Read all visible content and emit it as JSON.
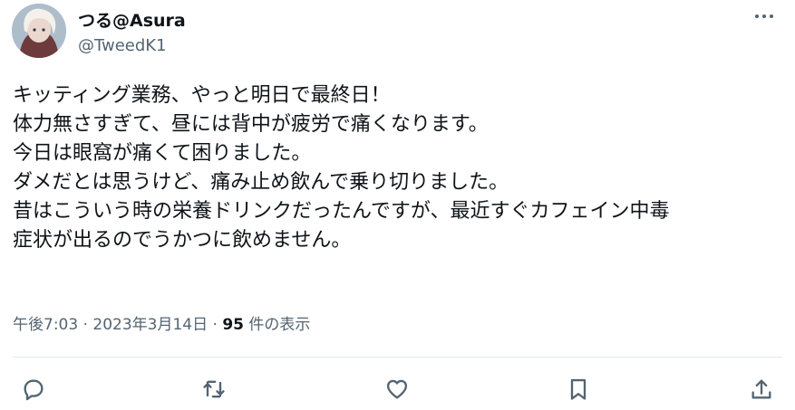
{
  "user": {
    "display_name": "つる@Asura",
    "handle": "@TweedK1",
    "avatar_icon": "avatar-photo"
  },
  "menu": {
    "icon": "more-horizontal-icon"
  },
  "tweet": {
    "lines": [
      "キッティング業務、やっと明日で最終日！",
      "体力無さすぎて、昼には背中が疲労で痛くなります。",
      "今日は眼窩が痛くて困りました。",
      "ダメだとは思うけど、痛み止め飲んで乗り切りました。",
      "昔はこういう時の栄養ドリンクだったんですが、最近すぐカフェイン中毒",
      "症状が出るのでうかつに飲めません。"
    ]
  },
  "meta": {
    "timestamp": "午後7:03 · 2023年3月14日 · ",
    "views_count": "95",
    "views_label": " 件の表示"
  },
  "actions": {
    "reply_icon": "reply-icon",
    "retweet_icon": "retweet-icon",
    "like_icon": "like-icon",
    "bookmark_icon": "bookmark-icon",
    "share_icon": "share-icon"
  },
  "colors": {
    "text": "#0f1419",
    "secondary": "#536471",
    "divider": "#e3e8eb"
  }
}
